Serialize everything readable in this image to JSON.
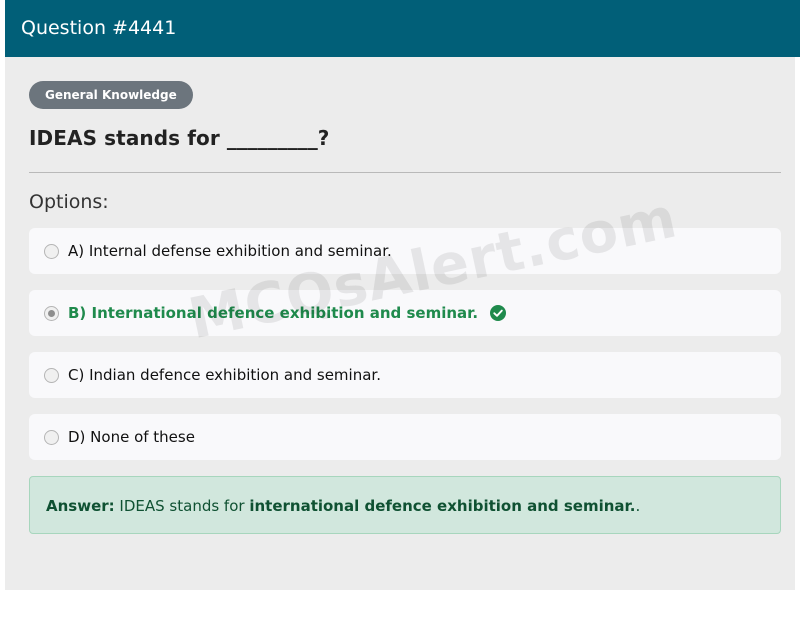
{
  "header": {
    "title": "Question #4441"
  },
  "category": {
    "label": "General Knowledge"
  },
  "question": {
    "text": "IDEAS stands for _________?"
  },
  "options_heading": "Options:",
  "options": [
    {
      "label": "A) Internal defense exhibition and seminar.",
      "selected": false,
      "correct": false
    },
    {
      "label": "B) International defence exhibition and seminar.",
      "selected": true,
      "correct": true
    },
    {
      "label": "C) Indian defence exhibition and seminar.",
      "selected": false,
      "correct": false
    },
    {
      "label": "D) None of these",
      "selected": false,
      "correct": false
    }
  ],
  "answer": {
    "label": "Answer:",
    "prefix": " IDEAS stands for ",
    "emphasis": "international defence exhibition and seminar.",
    "suffix": "."
  },
  "watermark": "MCQsAlert.com",
  "colors": {
    "header": "#015f78",
    "correct": "#1f8a4c",
    "answer_bg": "#d1e7dd"
  },
  "icons": {
    "correct_marker": "check-circle-icon"
  }
}
